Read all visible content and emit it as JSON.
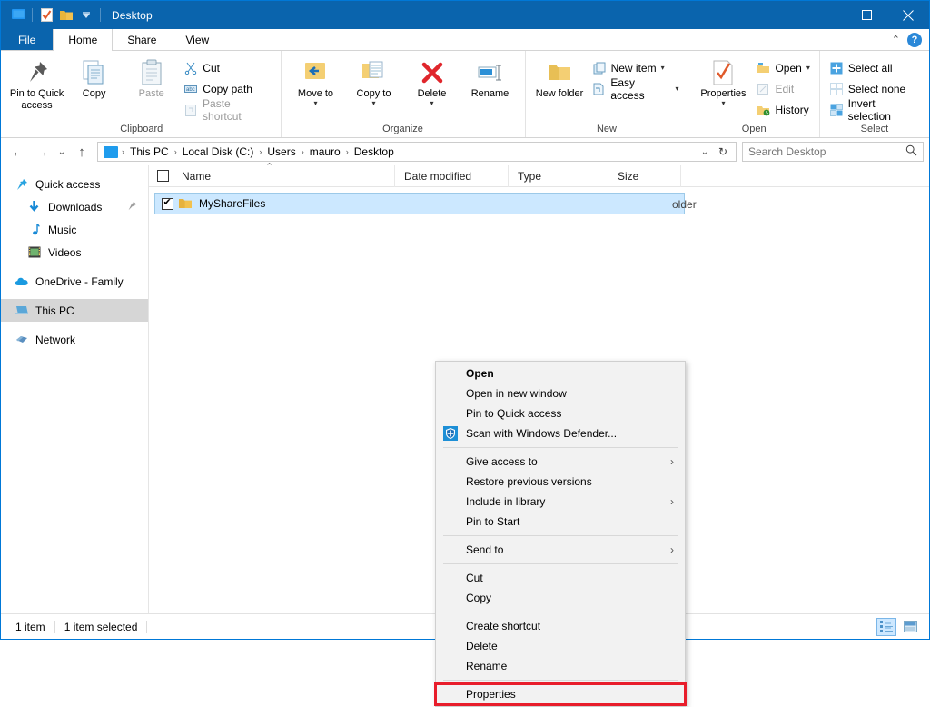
{
  "window": {
    "title": "Desktop",
    "titlebar_icons": [
      "explorer-icon",
      "properties-quick-icon",
      "folder-quick-icon",
      "customize-dropdown-icon"
    ],
    "minimize_label": "‒",
    "maximize_label": "☐",
    "close_label": "✕",
    "accent_color": "#0a64ad"
  },
  "ribbon": {
    "tabs": [
      {
        "label": "File",
        "kind": "file"
      },
      {
        "label": "Home",
        "kind": "active"
      },
      {
        "label": "Share",
        "kind": "normal"
      },
      {
        "label": "View",
        "kind": "normal"
      }
    ],
    "collapse_label": "⌃",
    "help_label": "?",
    "groups": [
      {
        "name": "Clipboard",
        "big": [
          {
            "label": "Pin to Quick access",
            "icon": "pin-icon"
          },
          {
            "label": "Copy",
            "icon": "copy-icon"
          },
          {
            "label": "Paste",
            "icon": "paste-icon",
            "disabled": true
          }
        ],
        "small": [
          {
            "label": "Cut",
            "icon": "scissors-icon",
            "disabled": false
          },
          {
            "label": "Copy path",
            "icon": "copy-path-icon",
            "disabled": false
          },
          {
            "label": "Paste shortcut",
            "icon": "paste-shortcut-icon",
            "disabled": true
          }
        ]
      },
      {
        "name": "Organize",
        "big": [
          {
            "label": "Move to",
            "icon": "move-to-icon",
            "caret": true
          },
          {
            "label": "Copy to",
            "icon": "copy-to-icon",
            "caret": true
          },
          {
            "label": "Delete",
            "icon": "delete-icon",
            "caret": true
          },
          {
            "label": "Rename",
            "icon": "rename-icon"
          }
        ],
        "small": []
      },
      {
        "name": "New",
        "big": [
          {
            "label": "New folder",
            "icon": "new-folder-icon"
          }
        ],
        "small": [
          {
            "label": "New item",
            "icon": "new-item-icon",
            "caret": true
          },
          {
            "label": "Easy access",
            "icon": "easy-access-icon",
            "caret": true
          }
        ]
      },
      {
        "name": "Open",
        "big": [
          {
            "label": "Properties",
            "icon": "properties-icon",
            "caret": true
          }
        ],
        "small": [
          {
            "label": "Open",
            "icon": "open-folder-icon",
            "caret": true
          },
          {
            "label": "Edit",
            "icon": "edit-icon",
            "disabled": true
          },
          {
            "label": "History",
            "icon": "history-icon"
          }
        ]
      },
      {
        "name": "Select",
        "big": [],
        "small": [
          {
            "label": "Select all",
            "icon": "select-all-icon"
          },
          {
            "label": "Select none",
            "icon": "select-none-icon"
          },
          {
            "label": "Invert selection",
            "icon": "invert-selection-icon"
          }
        ]
      }
    ]
  },
  "address": {
    "back_label": "←",
    "forward_label": "→",
    "recent_label": "⌄",
    "up_label": "↑",
    "breadcrumbs": [
      "This PC",
      "Local Disk (C:)",
      "Users",
      "mauro",
      "Desktop"
    ],
    "separator": "›",
    "dropdown_label": "⌄",
    "refresh_label": "↻"
  },
  "search": {
    "placeholder": "Search Desktop",
    "value": "",
    "icon": "search-icon"
  },
  "sidebar": {
    "items": [
      {
        "label": "Quick access",
        "icon": "pin-star-icon",
        "indent": false,
        "selected": false,
        "pinned": false
      },
      {
        "label": "Downloads",
        "icon": "download-icon",
        "indent": true,
        "selected": false,
        "pinned": true
      },
      {
        "label": "Music",
        "icon": "music-icon",
        "indent": true,
        "selected": false,
        "pinned": false
      },
      {
        "label": "Videos",
        "icon": "video-icon",
        "indent": true,
        "selected": false,
        "pinned": false
      },
      {
        "label": "OneDrive - Family",
        "icon": "onedrive-icon",
        "indent": false,
        "selected": false,
        "pinned": false
      },
      {
        "label": "This PC",
        "icon": "this-pc-icon",
        "indent": false,
        "selected": true,
        "pinned": false
      },
      {
        "label": "Network",
        "icon": "network-icon",
        "indent": false,
        "selected": false,
        "pinned": false
      }
    ]
  },
  "filelist": {
    "columns": [
      {
        "label": "Name",
        "key": "name"
      },
      {
        "label": "Date modified",
        "key": "date"
      },
      {
        "label": "Type",
        "key": "type"
      },
      {
        "label": "Size",
        "key": "size"
      }
    ],
    "sort_indicator": "⌃",
    "rows": [
      {
        "name": "MyShareFiles",
        "date": "",
        "type": "File folder",
        "size": "",
        "checked": true,
        "selected": true,
        "icon": "folder-icon"
      }
    ],
    "type_visible_text": "older"
  },
  "context_menu": {
    "items": [
      {
        "label": "Open",
        "bold": true,
        "icon": "",
        "arrow": false
      },
      {
        "label": "Open in new window",
        "bold": false,
        "icon": "",
        "arrow": false
      },
      {
        "label": "Pin to Quick access",
        "bold": false,
        "icon": "",
        "arrow": false
      },
      {
        "label": "Scan with Windows Defender...",
        "bold": false,
        "icon": "defender-shield-icon",
        "arrow": false
      },
      {
        "separator": true
      },
      {
        "label": "Give access to",
        "bold": false,
        "icon": "",
        "arrow": true
      },
      {
        "label": "Restore previous versions",
        "bold": false,
        "icon": "",
        "arrow": false
      },
      {
        "label": "Include in library",
        "bold": false,
        "icon": "",
        "arrow": true
      },
      {
        "label": "Pin to Start",
        "bold": false,
        "icon": "",
        "arrow": false
      },
      {
        "separator": true
      },
      {
        "label": "Send to",
        "bold": false,
        "icon": "",
        "arrow": true
      },
      {
        "separator": true
      },
      {
        "label": "Cut",
        "bold": false,
        "icon": "",
        "arrow": false
      },
      {
        "label": "Copy",
        "bold": false,
        "icon": "",
        "arrow": false
      },
      {
        "separator": true
      },
      {
        "label": "Create shortcut",
        "bold": false,
        "icon": "",
        "arrow": false
      },
      {
        "label": "Delete",
        "bold": false,
        "icon": "",
        "arrow": false
      },
      {
        "label": "Rename",
        "bold": false,
        "icon": "",
        "arrow": false
      },
      {
        "separator": true
      },
      {
        "label": "Properties",
        "bold": false,
        "icon": "",
        "arrow": false,
        "highlight": true
      }
    ],
    "arrow_glyph": "›",
    "highlight_color": "#e81d2b"
  },
  "statusbar": {
    "item_count": "1 item",
    "selection_count": "1 item selected",
    "views": [
      {
        "name": "details-view-button",
        "active": true
      },
      {
        "name": "large-icons-view-button",
        "active": false
      }
    ]
  }
}
